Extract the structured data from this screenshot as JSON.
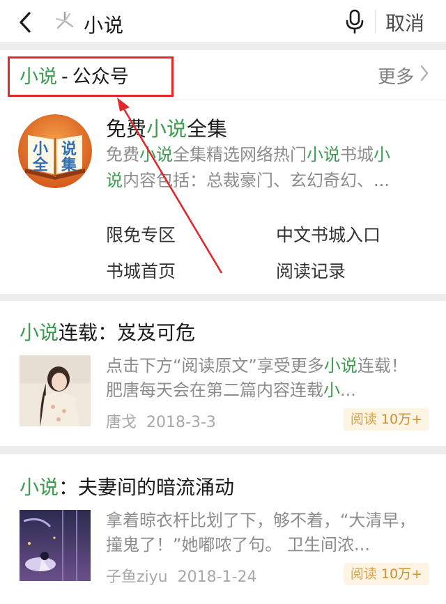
{
  "search": {
    "query": "小说",
    "cancel_label": "取消"
  },
  "accounts": {
    "section_keyword": "小说",
    "section_dash": "-",
    "section_label": "公众号",
    "more_label": "更多",
    "item": {
      "avatar_text": [
        "小",
        "说",
        "全",
        "集"
      ],
      "name_prefix": "免费",
      "name_keyword": "小说",
      "name_suffix": "全集",
      "desc_parts": [
        "免费",
        "小说",
        "全集精选网络热门",
        "小说",
        "书城",
        "小",
        "说",
        "内容包括：总裁豪门、玄幻奇幻、..."
      ],
      "menu": [
        "限免专区",
        "中文书城入口",
        "书城首页",
        "阅读记录"
      ]
    }
  },
  "articles": [
    {
      "title_keyword": "小说",
      "title_rest": "连载：岌岌可危",
      "snippet_parts": [
        "点击下方“阅读原文”享受更多",
        "小说",
        "连载！ 肥唐每天会在第二篇内容连载",
        "小",
        "..."
      ],
      "author": "唐戈",
      "date": "2018-3-3",
      "reads_label": "阅读",
      "reads_value": "10万+"
    },
    {
      "title_keyword": "小说",
      "title_rest": "：夫妻间的暗流涌动",
      "snippet": "拿着晾衣杆比划了下，够不着，“大清早，撞鬼了！”她嘟哝了句。 卫生间浓...",
      "author": "子鱼ziyu",
      "date": "2018-1-24",
      "reads_label": "阅读",
      "reads_value": "10万+"
    }
  ],
  "colors": {
    "highlight": "#3b9c4e",
    "annotation": "#e1282b",
    "badge_bg": "#fdf4e3"
  },
  "icons": [
    "back-arrow-icon",
    "wechat-search-logo-icon",
    "microphone-icon",
    "chevron-right-icon"
  ]
}
